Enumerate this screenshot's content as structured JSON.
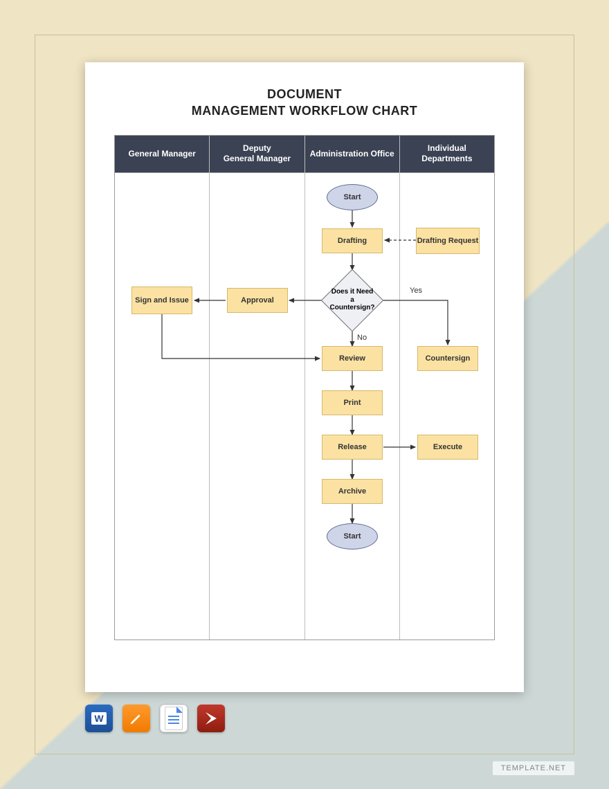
{
  "title_line1": "DOCUMENT",
  "title_line2": "MANAGEMENT WORKFLOW CHART",
  "lanes": [
    "General Manager",
    "Deputy\nGeneral Manager",
    "Administration Office",
    "Individual Departments"
  ],
  "nodes": {
    "start": "Start",
    "drafting": "Drafting",
    "drafting_request": "Drafting Request",
    "decision": "Does it Need a Countersign?",
    "approval": "Approval",
    "sign_issue": "Sign and Issue",
    "countersign": "Countersign",
    "review": "Review",
    "print": "Print",
    "release": "Release",
    "execute": "Execute",
    "archive": "Archive",
    "end": "Start"
  },
  "labels": {
    "yes": "Yes",
    "no": "No"
  },
  "icons": {
    "word": "W",
    "pages": "pages-icon",
    "docs": "docs-icon",
    "pdf": "pdf-icon"
  },
  "credit": "TEMPLATE.NET"
}
